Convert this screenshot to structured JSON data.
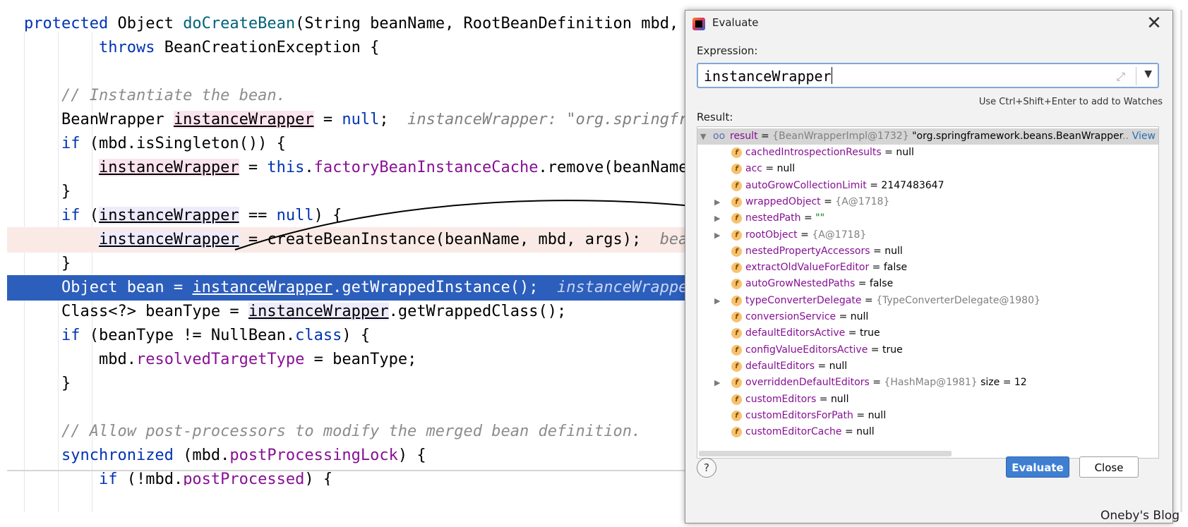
{
  "editor": {
    "lines": [
      {
        "parts": [
          {
            "t": "protected",
            "c": "t-kw"
          },
          {
            "t": " Object "
          },
          {
            "t": "doCreateBean",
            "c": "t-fn"
          },
          {
            "t": "(String beanName, RootBeanDefinition mbd, "
          },
          {
            "t": "@",
            "c": "t-ann"
          }
        ]
      },
      {
        "parts": [
          {
            "t": "        "
          },
          {
            "t": "throws",
            "c": "t-kw"
          },
          {
            "t": " BeanCreationException {"
          }
        ]
      },
      {
        "parts": []
      },
      {
        "parts": [
          {
            "t": "    "
          },
          {
            "t": "// Instantiate the bean.",
            "c": "t-cm"
          }
        ]
      },
      {
        "parts": [
          {
            "t": "    BeanWrapper "
          },
          {
            "t": "instanceWrapper",
            "c": "t-var bg-pink"
          },
          {
            "t": " = "
          },
          {
            "t": "null",
            "c": "t-kw"
          },
          {
            "t": ";  "
          },
          {
            "t": "instanceWrapper: \"org.springframew",
            "c": "t-hint"
          }
        ]
      },
      {
        "parts": [
          {
            "t": "    "
          },
          {
            "t": "if",
            "c": "t-kw"
          },
          {
            "t": " (mbd.isSingleton()) {"
          }
        ]
      },
      {
        "parts": [
          {
            "t": "        "
          },
          {
            "t": "instanceWrapper",
            "c": "t-var bg-pink"
          },
          {
            "t": " = "
          },
          {
            "t": "this",
            "c": "t-kw"
          },
          {
            "t": "."
          },
          {
            "t": "factoryBeanInstanceCache",
            "c": "t-fld"
          },
          {
            "t": ".remove(beanName);"
          }
        ]
      },
      {
        "parts": [
          {
            "t": "    }"
          }
        ]
      },
      {
        "parts": [
          {
            "t": "    "
          },
          {
            "t": "if",
            "c": "t-kw"
          },
          {
            "t": " ("
          },
          {
            "t": "instanceWrapper",
            "c": "t-var bg-lilac"
          },
          {
            "t": " == "
          },
          {
            "t": "null",
            "c": "t-kw"
          },
          {
            "t": ") {"
          }
        ]
      },
      {
        "parts": [
          {
            "t": "        "
          },
          {
            "t": "instanceWrapper",
            "c": "t-var bg-lilac"
          },
          {
            "t": " = createBeanInstance(beanName, mbd, args);  "
          },
          {
            "t": "bean",
            "c": "t-hint"
          }
        ]
      },
      {
        "parts": [
          {
            "t": "    }"
          }
        ]
      },
      {
        "parts": [
          {
            "t": "    Object bean = "
          },
          {
            "t": "instanceWrapper",
            "c": "t-var"
          },
          {
            "t": ".getWrappedInstance();  "
          },
          {
            "t": "instanceWrapper",
            "c": "t-hint"
          }
        ]
      },
      {
        "parts": [
          {
            "t": "    Class<?> beanType = "
          },
          {
            "t": "instanceWrapper",
            "c": "t-var bg-lilac"
          },
          {
            "t": ".getWrappedClass();"
          }
        ]
      },
      {
        "parts": [
          {
            "t": "    "
          },
          {
            "t": "if",
            "c": "t-kw"
          },
          {
            "t": " (beanType != NullBean."
          },
          {
            "t": "class",
            "c": "t-kw"
          },
          {
            "t": ") {"
          }
        ]
      },
      {
        "parts": [
          {
            "t": "        mbd."
          },
          {
            "t": "resolvedTargetType",
            "c": "t-fld"
          },
          {
            "t": " = beanType;"
          }
        ]
      },
      {
        "parts": [
          {
            "t": "    }"
          }
        ]
      },
      {
        "parts": []
      },
      {
        "parts": [
          {
            "t": "    "
          },
          {
            "t": "// Allow post-processors to modify the merged bean definition.",
            "c": "t-cm"
          }
        ]
      },
      {
        "parts": [
          {
            "t": "    "
          },
          {
            "t": "synchronized",
            "c": "t-kw"
          },
          {
            "t": " (mbd."
          },
          {
            "t": "postProcessingLock",
            "c": "t-fld"
          },
          {
            "t": ") {"
          }
        ]
      },
      {
        "parts": [
          {
            "t": "        "
          },
          {
            "t": "if",
            "c": "t-kw"
          },
          {
            "t": " (!mbd."
          },
          {
            "t": "postProcessed",
            "c": "t-fld"
          },
          {
            "t": ") {"
          }
        ]
      }
    ]
  },
  "dialog": {
    "title": "Evaluate",
    "close_glyph": "✕",
    "expression_label": "Expression:",
    "expression_value": "instanceWrapper",
    "hint": "Use Ctrl+Shift+Enter to add to Watches",
    "result_label": "Result:",
    "root": {
      "name": "result",
      "ref": "{BeanWrapperImpl@1732}",
      "value": "\"org.springframework.beans.BeanWrapper",
      "ellipsis": "...",
      "view": "View"
    },
    "fields": [
      {
        "name": "cachedIntrospectionResults",
        "value": "null",
        "kind": "plain",
        "expandable": false
      },
      {
        "name": "acc",
        "value": "null",
        "kind": "plain",
        "expandable": false
      },
      {
        "name": "autoGrowCollectionLimit",
        "value": "2147483647",
        "kind": "plain",
        "expandable": false
      },
      {
        "name": "wrappedObject",
        "value": "{A@1718}",
        "kind": "ref",
        "expandable": true
      },
      {
        "name": "nestedPath",
        "value": "\"\"",
        "kind": "str",
        "expandable": true
      },
      {
        "name": "rootObject",
        "value": "{A@1718}",
        "kind": "ref",
        "expandable": true
      },
      {
        "name": "nestedPropertyAccessors",
        "value": "null",
        "kind": "plain",
        "expandable": false
      },
      {
        "name": "extractOldValueForEditor",
        "value": "false",
        "kind": "plain",
        "expandable": false
      },
      {
        "name": "autoGrowNestedPaths",
        "value": "false",
        "kind": "plain",
        "expandable": false
      },
      {
        "name": "typeConverterDelegate",
        "value": "{TypeConverterDelegate@1980}",
        "kind": "ref",
        "expandable": true
      },
      {
        "name": "conversionService",
        "value": "null",
        "kind": "plain",
        "expandable": false
      },
      {
        "name": "defaultEditorsActive",
        "value": "true",
        "kind": "plain",
        "expandable": false
      },
      {
        "name": "configValueEditorsActive",
        "value": "true",
        "kind": "plain",
        "expandable": false
      },
      {
        "name": "defaultEditors",
        "value": "null",
        "kind": "plain",
        "expandable": false
      },
      {
        "name": "overriddenDefaultEditors",
        "value": "{HashMap@1981}",
        "extra": "size = 12",
        "kind": "ref",
        "expandable": true
      },
      {
        "name": "customEditors",
        "value": "null",
        "kind": "plain",
        "expandable": false
      },
      {
        "name": "customEditorsForPath",
        "value": "null",
        "kind": "plain",
        "expandable": false
      },
      {
        "name": "customEditorCache",
        "value": "null",
        "kind": "plain",
        "expandable": false
      }
    ],
    "help_label": "?",
    "evaluate_label": "Evaluate",
    "close_label": "Close"
  },
  "watermark": "Oneby's Blog",
  "colors": {
    "selection": "#2c5ebc",
    "exec_line": "#faeae6",
    "keyword": "#0033b3",
    "field": "#871094",
    "primary_button": "#3f7fd2"
  }
}
